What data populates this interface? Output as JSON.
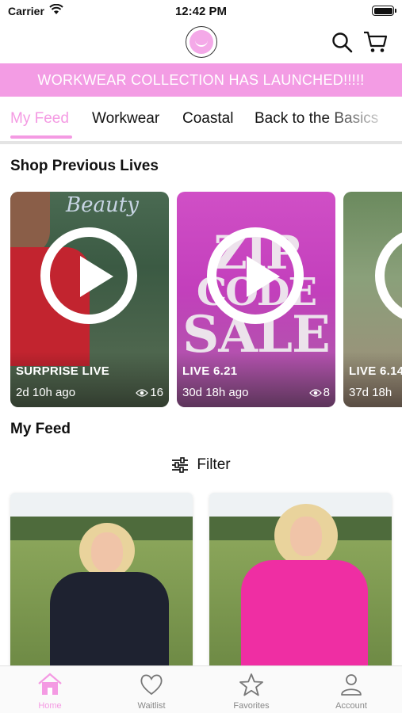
{
  "status_bar": {
    "carrier": "Carrier",
    "time": "12:42 PM"
  },
  "nav": {
    "logo_icon": "brand-logo",
    "search_icon": "search-icon",
    "cart_icon": "cart-icon"
  },
  "banner": {
    "text": "WORKWEAR COLLECTION HAS LAUNCHED!!!!!"
  },
  "tabs": [
    {
      "label": "My Feed",
      "active": true
    },
    {
      "label": "Workwear"
    },
    {
      "label": "Coastal"
    },
    {
      "label": "Back to the Basics"
    }
  ],
  "accent_color": "#f49ae3",
  "shop_previous_lives": {
    "title": "Shop Previous Lives",
    "cards": [
      {
        "title": "SURPRISE LIVE",
        "ago": "2d 10h ago",
        "views": "16"
      },
      {
        "title": "LIVE 6.21",
        "ago": "30d 18h ago",
        "views": "8",
        "art_text": [
          "ZIP",
          "CODE",
          "SALE"
        ]
      },
      {
        "title": "LIVE 6.14",
        "ago": "37d 18h"
      }
    ]
  },
  "my_feed": {
    "title": "My Feed",
    "filter_label": "Filter"
  },
  "tabbar": [
    {
      "label": "Home",
      "icon": "home-icon",
      "active": true
    },
    {
      "label": "Waitlist",
      "icon": "heart-icon"
    },
    {
      "label": "Favorites",
      "icon": "star-icon"
    },
    {
      "label": "Account",
      "icon": "person-icon"
    }
  ]
}
